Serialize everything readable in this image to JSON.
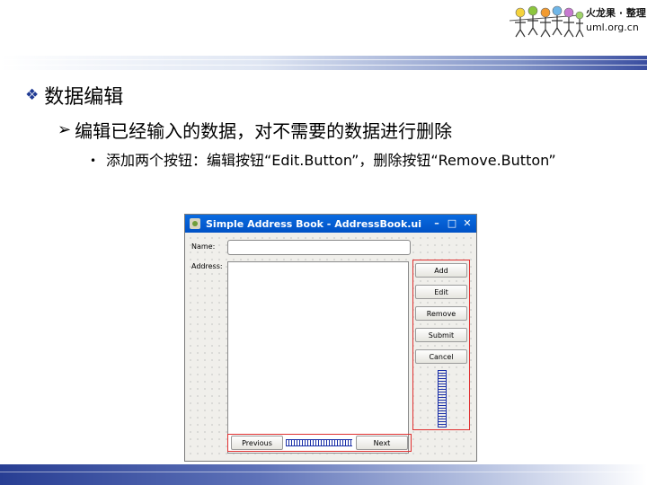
{
  "logo": {
    "brand": "火龙果 · 整理",
    "domain": "uml.org.cn"
  },
  "slide": {
    "heading": "数据编辑",
    "subheading": "编辑已经输入的数据，对不需要的数据进行删除",
    "bullet": "添加两个按钮：编辑按钮“Edit.Button”，删除按钮“Remove.Button”"
  },
  "window": {
    "title": "Simple Address Book - AddressBook.ui",
    "controls": {
      "minimize": "–",
      "maximize": "□",
      "close": "✕"
    },
    "name_label": "Name:",
    "address_label": "Address:",
    "buttons": [
      "Add",
      "Edit",
      "Remove",
      "Submit",
      "Cancel"
    ],
    "nav": {
      "previous": "Previous",
      "next": "Next"
    }
  },
  "colors": {
    "accent": "#1f3a93",
    "titlebar": "#0a5fd6",
    "layout_outline": "#e03030",
    "spacer": "#1a2fa8"
  },
  "icons": {
    "heading_bullet": "diamond-cluster-icon",
    "subheading_bullet": "arrow-bullet-icon",
    "app": "designer-app-icon"
  }
}
